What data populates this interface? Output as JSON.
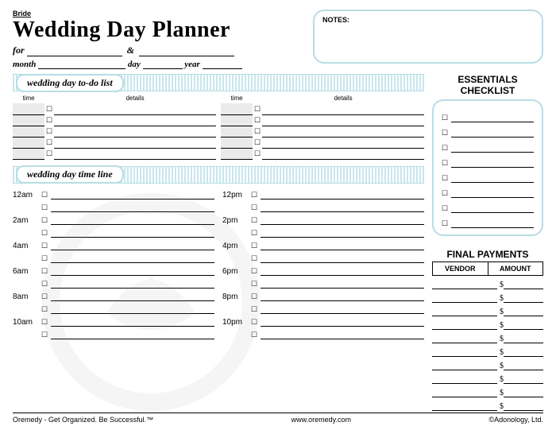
{
  "header": {
    "pre_title": "Bride",
    "title": "Wedding Day Planner",
    "for_label": "for",
    "amp": "&",
    "month_label": "month",
    "day_label": "day",
    "year_label": "year",
    "notes_label": "NOTES:"
  },
  "sections": {
    "todo_title": "wedding day to-do list",
    "timeline_title": "wedding day time line",
    "essentials_title": "ESSENTIALS CHECKLIST",
    "payments_title": "FINAL PAYMENTS"
  },
  "todo_headers": {
    "time": "time",
    "details": "details"
  },
  "timeline": {
    "left": [
      "12am",
      "",
      "2am",
      "",
      "4am",
      "",
      "6am",
      "",
      "8am",
      "",
      "10am",
      ""
    ],
    "right": [
      "12pm",
      "",
      "2pm",
      "",
      "4pm",
      "",
      "6pm",
      "",
      "8pm",
      "",
      "10pm",
      ""
    ]
  },
  "payments_headers": {
    "vendor": "VENDOR",
    "amount": "AMOUNT"
  },
  "dollar": "$",
  "checkbox": "☐",
  "footer": {
    "left": "Oremedy - Get Organized. Be Successful.™",
    "center": "www.oremedy.com",
    "right": "©Adonology, Ltd."
  }
}
